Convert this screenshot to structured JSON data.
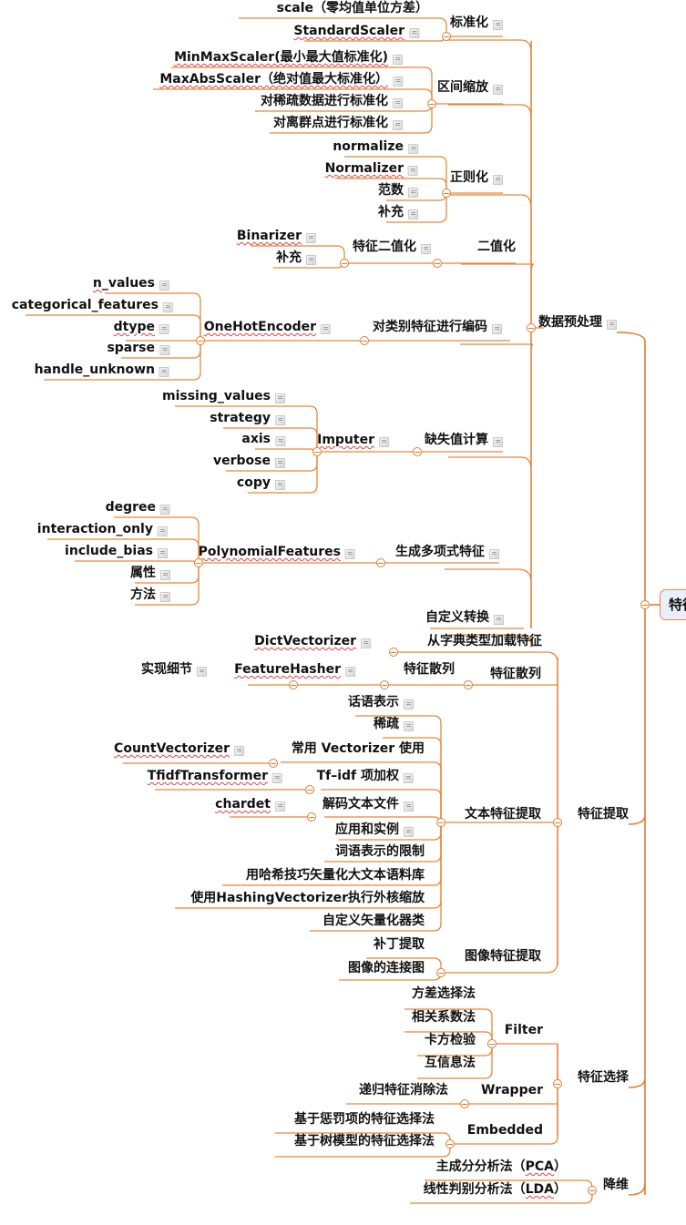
{
  "root": {
    "label": "特征工程"
  },
  "colors": {
    "link": "#e8883a",
    "link_main": "#e07b2c",
    "root_fill": "#eaf0fb",
    "spellcheck": "#e04040"
  },
  "branches": {
    "preprocess": {
      "label": "数据预处理",
      "children": {
        "standardize": {
          "label": "标准化",
          "items": [
            "scale（零均值单位方差）",
            "StandardScaler"
          ]
        },
        "range_scale": {
          "label": "区间缩放",
          "items": [
            "MinMaxScaler(最小最大值标准化)",
            "MaxAbsScaler（绝对值最大标准化）",
            "对稀疏数据进行标准化",
            "对离群点进行标准化"
          ]
        },
        "normalize": {
          "label": "正则化",
          "items": [
            "normalize",
            "Normalizer",
            "范数",
            "补充"
          ]
        },
        "binarize": {
          "label": "二值化",
          "sub": {
            "label": "特征二值化",
            "items": [
              "Binarizer",
              "补充"
            ]
          }
        },
        "encode": {
          "label": "对类别特征进行编码",
          "sub": {
            "label": "OneHotEncoder",
            "items": [
              "n_values",
              "categorical_features",
              "dtype",
              "sparse",
              "handle_unknown"
            ]
          }
        },
        "impute": {
          "label": "缺失值计算",
          "sub": {
            "label": "Imputer",
            "items": [
              "missing_values",
              "strategy",
              "axis",
              "verbose",
              "copy"
            ]
          }
        },
        "poly": {
          "label": "生成多项式特征",
          "sub": {
            "label": "PolynomialFeatures",
            "items": [
              "degree",
              "interaction_only",
              "include_bias",
              "属性",
              "方法"
            ]
          }
        },
        "custom": {
          "label": "自定义转换"
        }
      }
    },
    "extract": {
      "label": "特征提取",
      "children": {
        "dict": {
          "label": "从字典类型加载特征",
          "sub": "DictVectorizer"
        },
        "hashing": {
          "label": "特征散列",
          "sub": {
            "label": "特征散列",
            "item": "FeatureHasher",
            "leaf": "实现细节"
          }
        },
        "text": {
          "label": "文本特征提取",
          "items": [
            "话语表示",
            "稀疏",
            "常用 Vectorizer 使用",
            "Tf–idf 项加权",
            "解码文本文件",
            "应用和实例",
            "词语表示的限制",
            "用哈希技巧矢量化大文本语料库",
            "使用HashingVectorizer执行外核缩放",
            "自定义矢量化器类"
          ],
          "leaves": {
            "vectorizer": "CountVectorizer",
            "tfidf": "TfidfTransformer",
            "decode": "chardet"
          }
        },
        "image": {
          "label": "图像特征提取",
          "items": [
            "补丁提取",
            "图像的连接图"
          ]
        }
      }
    },
    "select": {
      "label": "特征选择",
      "children": {
        "filter": {
          "label": "Filter",
          "items": [
            "方差选择法",
            "相关系数法",
            "卡方检验",
            "互信息法"
          ]
        },
        "wrapper": {
          "label": "Wrapper",
          "items": [
            "递归特征消除法"
          ]
        },
        "embedded": {
          "label": "Embedded",
          "items": [
            "基于惩罚项的特征选择法",
            "基于树模型的特征选择法"
          ]
        }
      }
    },
    "reduce": {
      "label": "降维",
      "items": [
        "主成分分析法（PCA）",
        "线性判别分析法（LDA）"
      ]
    }
  }
}
